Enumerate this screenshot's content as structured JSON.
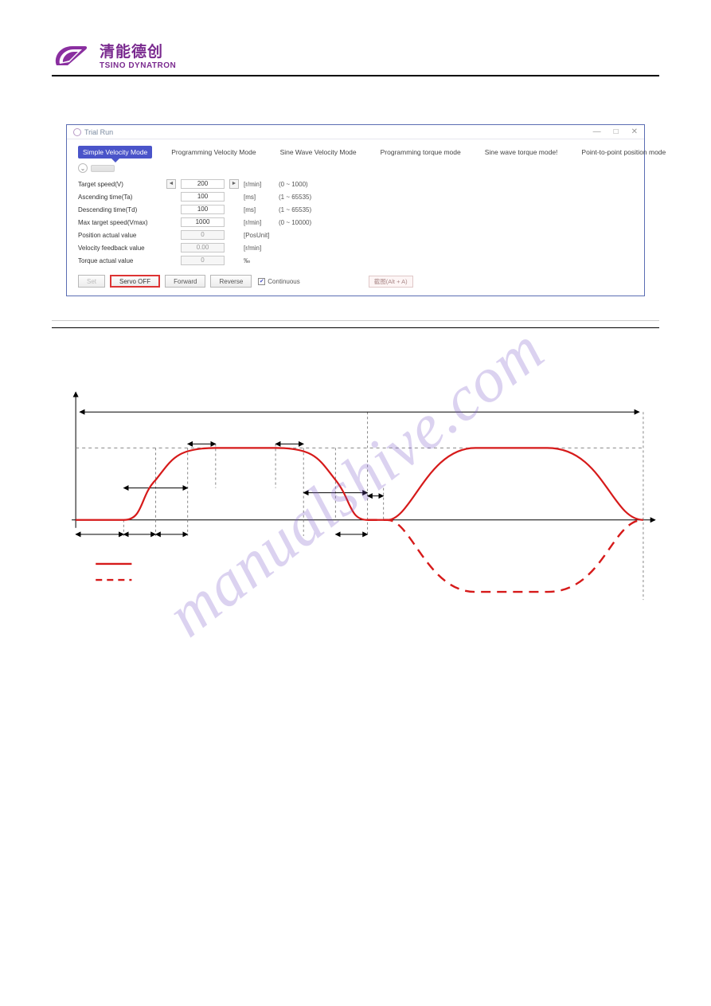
{
  "company": {
    "cn": "清能德创",
    "en": "TSINO DYNATRON"
  },
  "window": {
    "title": "Trial Run",
    "controls": {
      "min": "—",
      "max": "□",
      "close": "✕"
    }
  },
  "tabs": [
    "Simple Velocity Mode",
    "Programming Velocity Mode",
    "Sine Wave Velocity Mode",
    "Programming torque mode",
    "Sine wave torque mode!",
    "Point-to-point position mode"
  ],
  "params": [
    {
      "label": "Target speed(V)",
      "value": "200",
      "unit": "[r/min]",
      "range": "(0 ~ 1000)",
      "stepper": true,
      "ro": false
    },
    {
      "label": "Ascending time(Ta)",
      "value": "100",
      "unit": "[ms]",
      "range": "(1 ~ 65535)",
      "stepper": false,
      "ro": false
    },
    {
      "label": "Descending time(Td)",
      "value": "100",
      "unit": "[ms]",
      "range": "(1 ~ 65535)",
      "stepper": false,
      "ro": false
    },
    {
      "label": "Max target speed(Vmax)",
      "value": "1000",
      "unit": "[r/min]",
      "range": "(0 ~ 10000)",
      "stepper": false,
      "ro": false
    },
    {
      "label": "Position actual value",
      "value": "0",
      "unit": "[PosUnit]",
      "range": "",
      "stepper": false,
      "ro": true
    },
    {
      "label": "Velocity feedback value",
      "value": "0.00",
      "unit": "[r/min]",
      "range": "",
      "stepper": false,
      "ro": true
    },
    {
      "label": "Torque actual value",
      "value": "0",
      "unit": "‰",
      "range": "",
      "stepper": false,
      "ro": true
    }
  ],
  "buttons": {
    "set": "Set",
    "servo": "Servo OFF",
    "forward": "Forward",
    "reverse": "Reverse",
    "continuous": "Continuous",
    "check": "✔",
    "snip": "截图(Alt + A)"
  },
  "refresh_glyph": "⌄",
  "watermark": "manualshive.com"
}
